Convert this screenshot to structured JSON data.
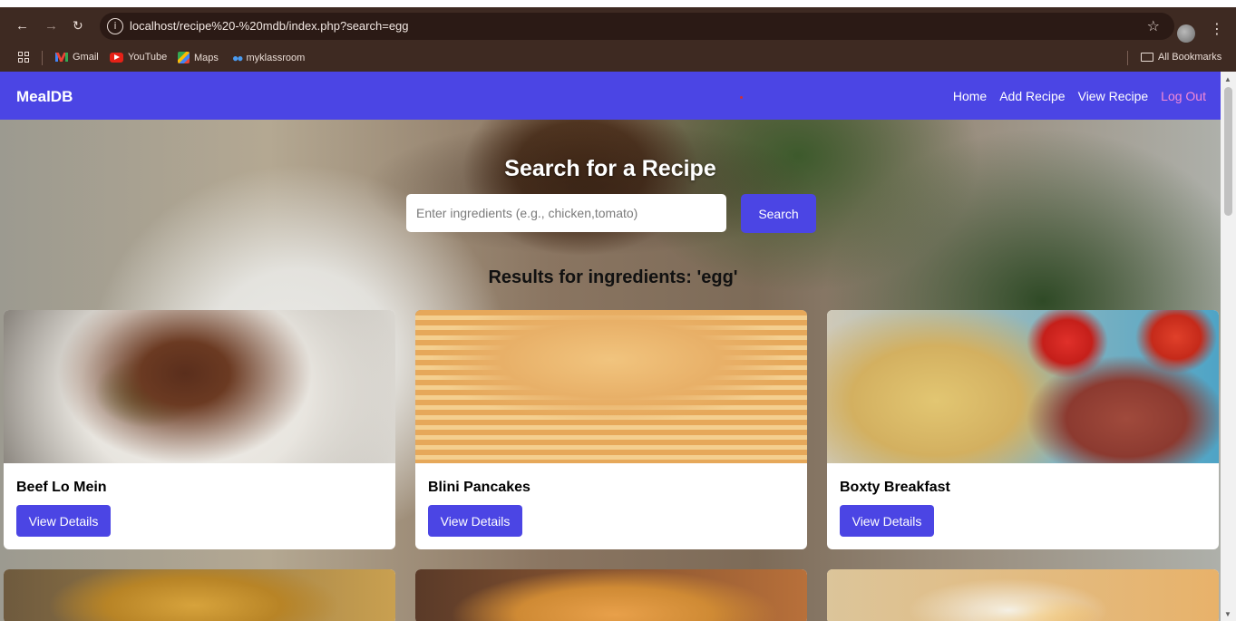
{
  "browser": {
    "url": "localhost/recipe%20-%20mdb/index.php?search=egg",
    "bookmarks": [
      {
        "label": "Gmail",
        "icon": "gmail-icon"
      },
      {
        "label": "YouTube",
        "icon": "youtube-icon"
      },
      {
        "label": "Maps",
        "icon": "maps-icon"
      },
      {
        "label": "myklassroom",
        "icon": "myklassroom-icon"
      }
    ],
    "all_bookmarks": "All Bookmarks"
  },
  "navbar": {
    "brand": "MealDB",
    "links": {
      "home": "Home",
      "add_recipe": "Add Recipe",
      "view_recipe": "View Recipe",
      "logout": "Log Out"
    },
    "colors": {
      "bar": "#4b45e4",
      "logout": "#f48ad6"
    }
  },
  "search": {
    "title": "Search for a Recipe",
    "placeholder": "Enter ingredients (e.g., chicken,tomato)",
    "value": "",
    "button": "Search"
  },
  "results": {
    "heading": "Results for ingredients: 'egg'",
    "cards": [
      {
        "title": "Beef Lo Mein",
        "button": "View Details"
      },
      {
        "title": "Blini Pancakes",
        "button": "View Details"
      },
      {
        "title": "Boxty Breakfast",
        "button": "View Details"
      }
    ]
  }
}
